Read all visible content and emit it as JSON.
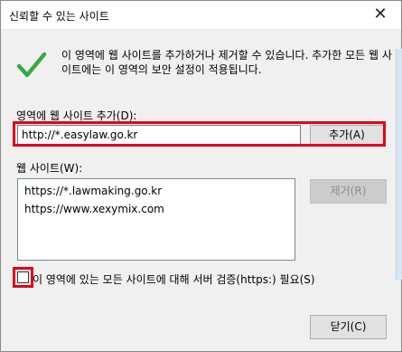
{
  "window": {
    "title": "신뢰할 수 있는 사이트",
    "close_glyph": "✕"
  },
  "info": {
    "icon": "check-icon",
    "description": "이 영역에 웹 사이트를 추가하거나 제거할 수 있습니다. 추가한 모든 웹 사이트에는 이 영역의 보안 설정이 적용됩니다."
  },
  "add_section": {
    "label": "영역에 웹 사이트 추가(D):",
    "input_value": "http://*.easylaw.go.kr",
    "add_button": "추가(A)"
  },
  "sites_section": {
    "label": "웹 사이트(W):",
    "sites": [
      "https://*.lawmaking.go.kr",
      "https://www.xexymix.com"
    ],
    "remove_button": "제거(R)"
  },
  "https_option": {
    "checked": false,
    "label": "이 영역에 있는 모든 사이트에 대해 서버 검증(https:) 필요(S)"
  },
  "footer": {
    "close_button": "닫기(C)"
  },
  "colors": {
    "highlight": "#e2001a",
    "check_green": "#3aa845"
  }
}
